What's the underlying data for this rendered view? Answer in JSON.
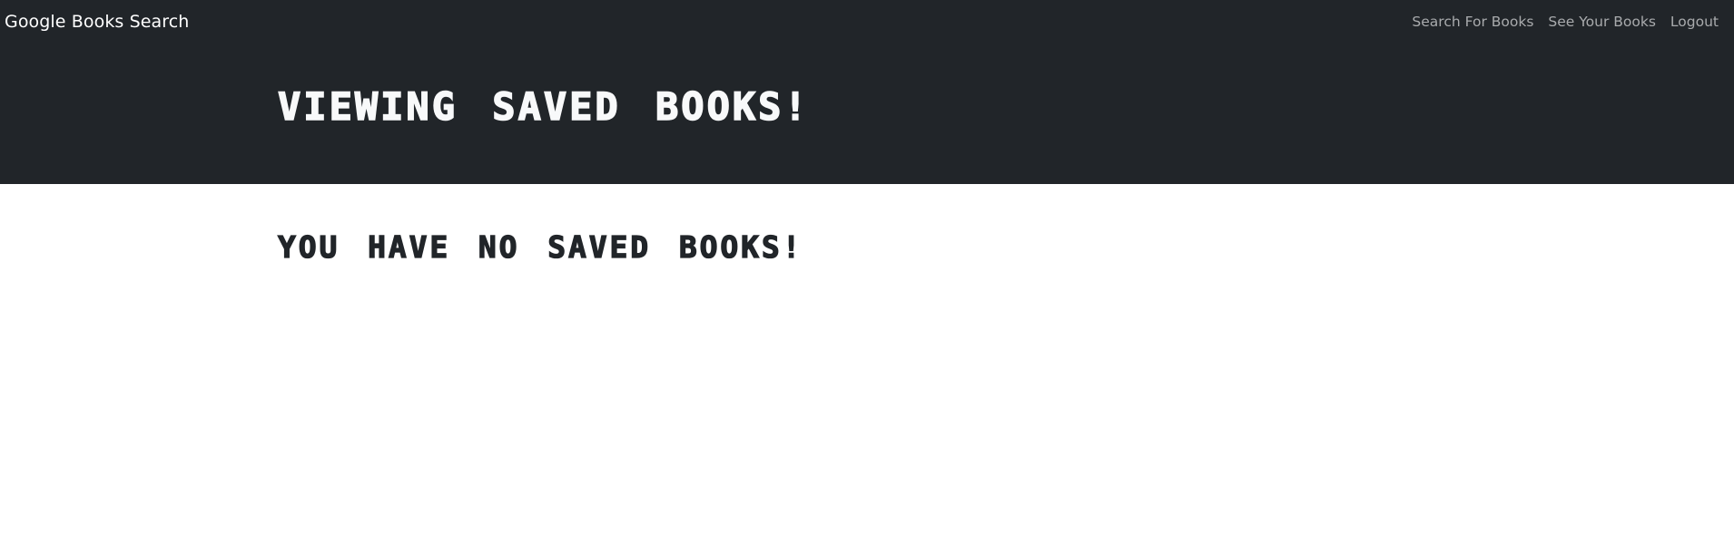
{
  "navbar": {
    "brand": "Google Books Search",
    "links": [
      {
        "label": "Search For Books"
      },
      {
        "label": "See Your Books"
      },
      {
        "label": "Logout"
      }
    ],
    "background": "#212529",
    "link_color": "#a9abad"
  },
  "header": {
    "title": "VIEWING SAVED BOOKS!"
  },
  "main": {
    "empty_message": "YOU HAVE NO SAVED BOOKS!"
  }
}
